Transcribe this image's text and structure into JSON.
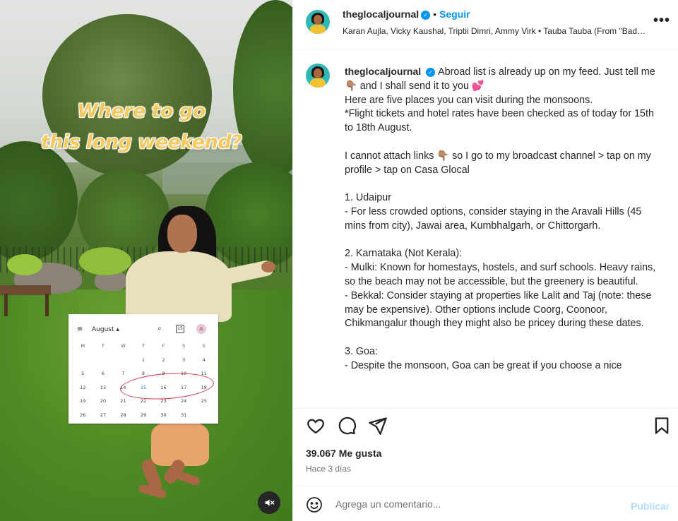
{
  "post": {
    "overlay_title": "Where to go\nthis long weekend?",
    "mute_icon": "speaker-muted-icon"
  },
  "calendar": {
    "month": "August ▴",
    "date_icon": "15",
    "avatar_initial": "A",
    "weekdays": [
      "M",
      "T",
      "W",
      "T",
      "F",
      "S",
      "S"
    ],
    "days": [
      "",
      "",
      "",
      "1",
      "2",
      "3",
      "4",
      "5",
      "6",
      "7",
      "8",
      "9",
      "10",
      "11",
      "12",
      "13",
      "14",
      "15",
      "16",
      "17",
      "18",
      "19",
      "20",
      "21",
      "22",
      "23",
      "24",
      "25",
      "26",
      "27",
      "28",
      "29",
      "30",
      "31",
      ""
    ],
    "highlighted_day": "15"
  },
  "header": {
    "username": "theglocaljournal",
    "separator": "•",
    "follow_label": "Seguir",
    "audio": "Karan Aujla, Vicky Kaushal, Triptii Dimri, Ammy Virk • Tauba Tauba (From \"Bad Newz\")",
    "more_label": "•••"
  },
  "caption": {
    "username": "theglocaljournal",
    "text": "Abroad list is already up on my feed. Just tell me 👇🏽 and I shall send it to you 💕\nHere are five places you can visit during the monsoons.\n*Flight tickets and hotel rates have been checked as of today for 15th to 18th August.\n\nI cannot attach links 👇🏽 so I go to my broadcast channel > tap on my profile > tap on Casa Glocal\n\n1. Udaipur\n- For less crowded options, consider staying in the Aravali Hills (45 mins from city), Jawai area, Kumbhalgarh, or Chittorgarh.\n\n2. Karnataka (Not Kerala):\n- Mulki: Known for homestays, hostels, and surf schools. Heavy rains, so the beach may not be accessible, but the greenery is beautiful.\n- Bekkal: Consider staying at properties like Lalit and Taj (note: these may be expensive). Other options include Coorg, Coonoor, Chikmangalur though they might also be pricey during these dates.\n\n3. Goa:\n- Despite the monsoon, Goa can be great if you choose a nice"
  },
  "actions": {
    "likes": "39.067 Me gusta",
    "time_ago": "Hace 3 días"
  },
  "comment": {
    "placeholder": "Agrega un comentario...",
    "publish_label": "Publicar"
  }
}
